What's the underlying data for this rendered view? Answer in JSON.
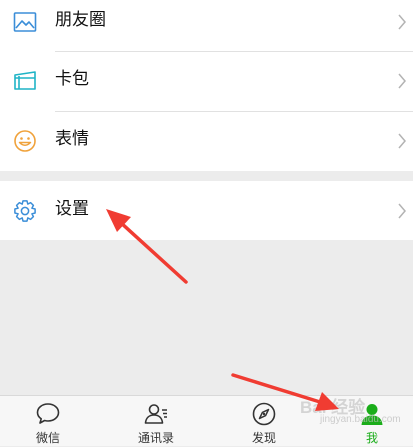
{
  "menu": {
    "items": [
      {
        "label": "朋友圈",
        "icon": "photo-icon"
      },
      {
        "label": "卡包",
        "icon": "card-wallet-icon"
      },
      {
        "label": "表情",
        "icon": "smiley-icon"
      },
      {
        "label": "设置",
        "icon": "gear-icon"
      }
    ]
  },
  "tabbar": {
    "tabs": [
      {
        "label": "微信",
        "icon": "chat-bubble-icon",
        "active": false
      },
      {
        "label": "通讯录",
        "icon": "contacts-icon",
        "active": false
      },
      {
        "label": "发现",
        "icon": "compass-icon",
        "active": false
      },
      {
        "label": "我",
        "icon": "person-icon",
        "active": true
      }
    ]
  },
  "watermark": {
    "text": "Bai 经验",
    "sub": "jingyan.baidu.com"
  },
  "colors": {
    "accent": "#1aad19",
    "icon_blue": "#3b8ed8",
    "icon_teal": "#1fb4c6",
    "icon_orange": "#f0a23b",
    "annotation_red": "#f03c32",
    "background": "#ececec"
  }
}
